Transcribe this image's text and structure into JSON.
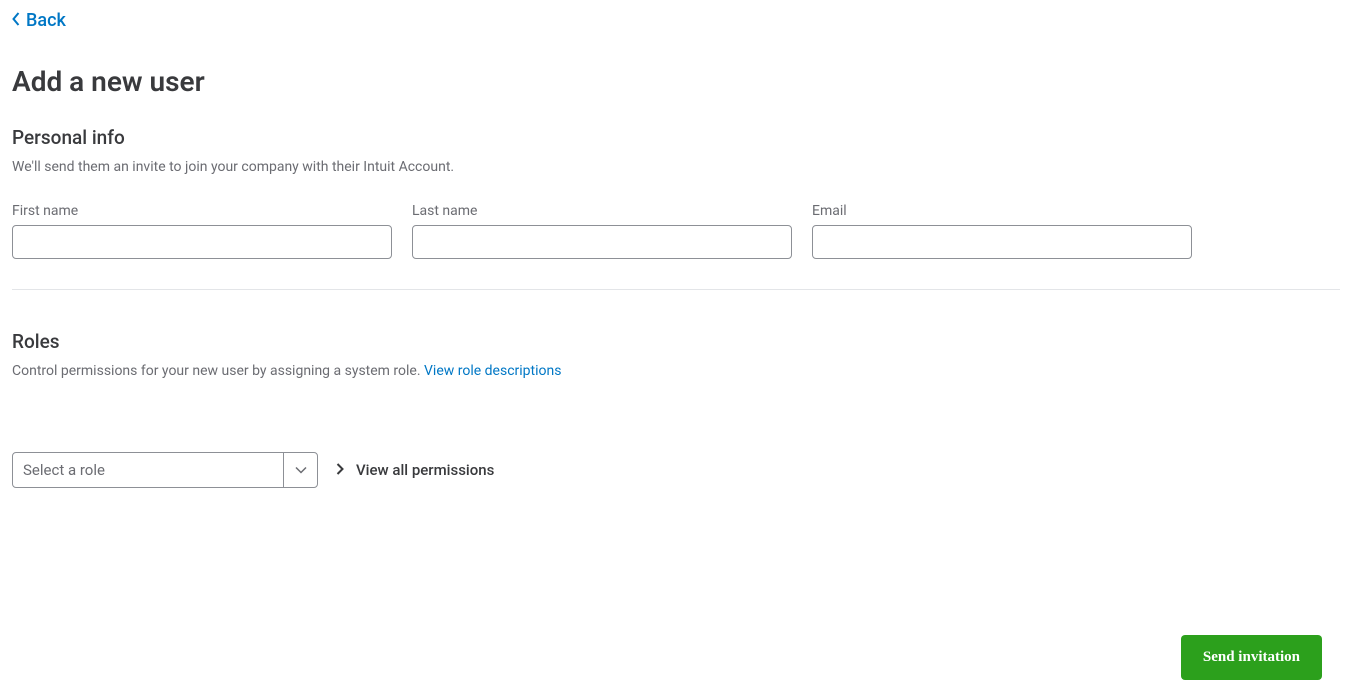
{
  "back": {
    "label": "Back"
  },
  "page": {
    "title": "Add a new user"
  },
  "personal": {
    "heading": "Personal info",
    "desc": "We'll send them an invite to join your company with their Intuit Account.",
    "first_name_label": "First name",
    "last_name_label": "Last name",
    "email_label": "Email",
    "first_name_value": "",
    "last_name_value": "",
    "email_value": ""
  },
  "roles": {
    "heading": "Roles",
    "desc": "Control permissions for your new user by assigning a system role. ",
    "link": "View role descriptions",
    "select_placeholder": "Select a role",
    "permissions_label": "View all permissions"
  },
  "footer": {
    "send_label": "Send invitation"
  }
}
